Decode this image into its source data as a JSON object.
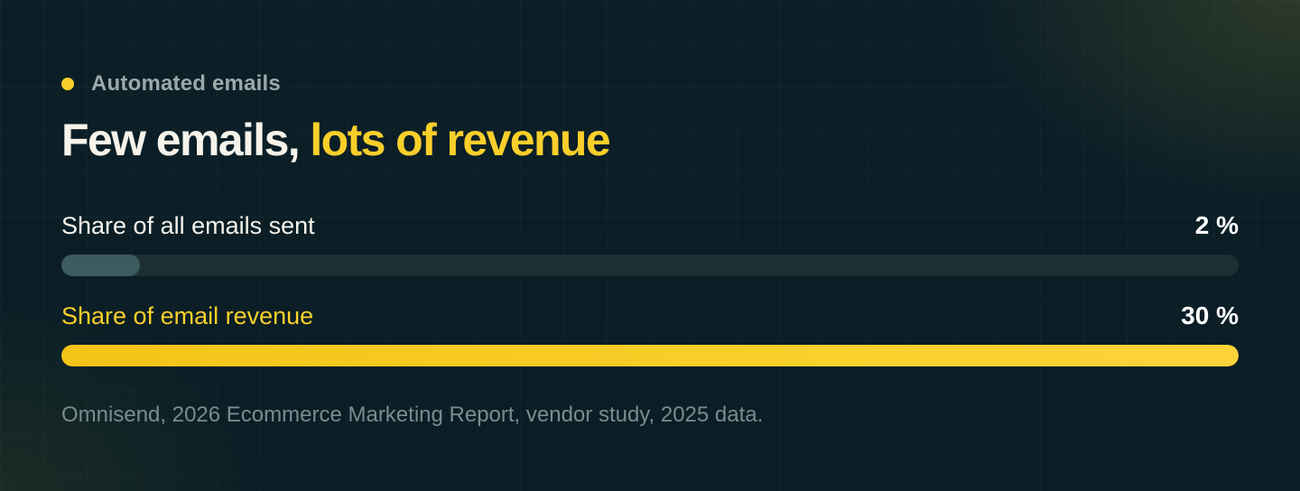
{
  "eyebrow": {
    "label": "Automated emails"
  },
  "headline": {
    "plain": "Few emails, ",
    "accent": "lots of revenue"
  },
  "source": "Omnisend, 2026 Ecommerce Marketing Report, vendor study, 2025 data.",
  "colors": {
    "accent": "#f9cf2a",
    "muted_fill": "#3d5a5e",
    "track": "#1b2f35",
    "background": "#0c1f27"
  },
  "chart_data": {
    "type": "bar",
    "orientation": "horizontal",
    "ylim": [
      0,
      30
    ],
    "categories": [
      "Share of all emails sent",
      "Share of email revenue"
    ],
    "values": [
      2,
      30
    ],
    "value_labels": [
      "2 %",
      "30 %"
    ],
    "series_colors": [
      "#3d5a5e",
      "#f9cf2a"
    ],
    "label_colors": [
      "#f5f3ea",
      "#f9cf2a"
    ]
  }
}
